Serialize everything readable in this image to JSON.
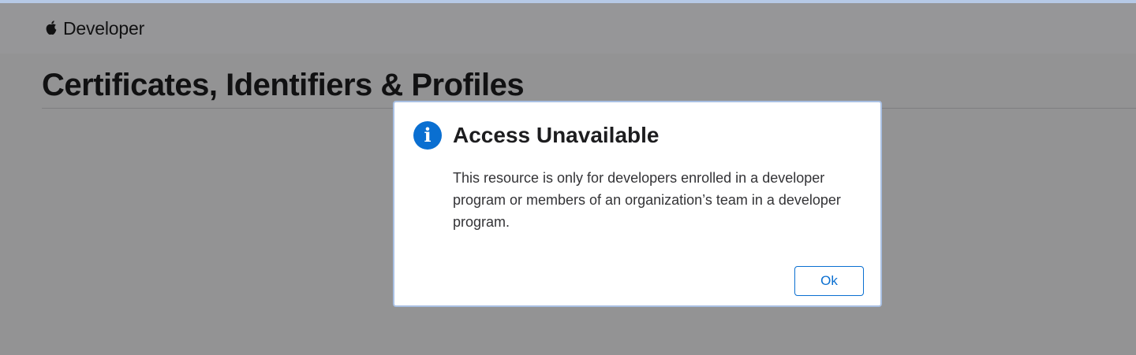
{
  "header": {
    "logo_icon": "apple-logo-icon",
    "brand_label": "Developer"
  },
  "page": {
    "title": "Certificates, Identifiers & Profiles"
  },
  "dialog": {
    "icon": "info-icon",
    "icon_glyph": "i",
    "title": "Access Unavailable",
    "message": "This resource is only for developers enrolled in a developer program or members of an organization’s team in a developer program.",
    "ok_label": "Ok"
  },
  "colors": {
    "accent": "#0a6fd1",
    "overlay": "rgba(0,0,0,0.4)",
    "text": "#1d1d1f"
  }
}
